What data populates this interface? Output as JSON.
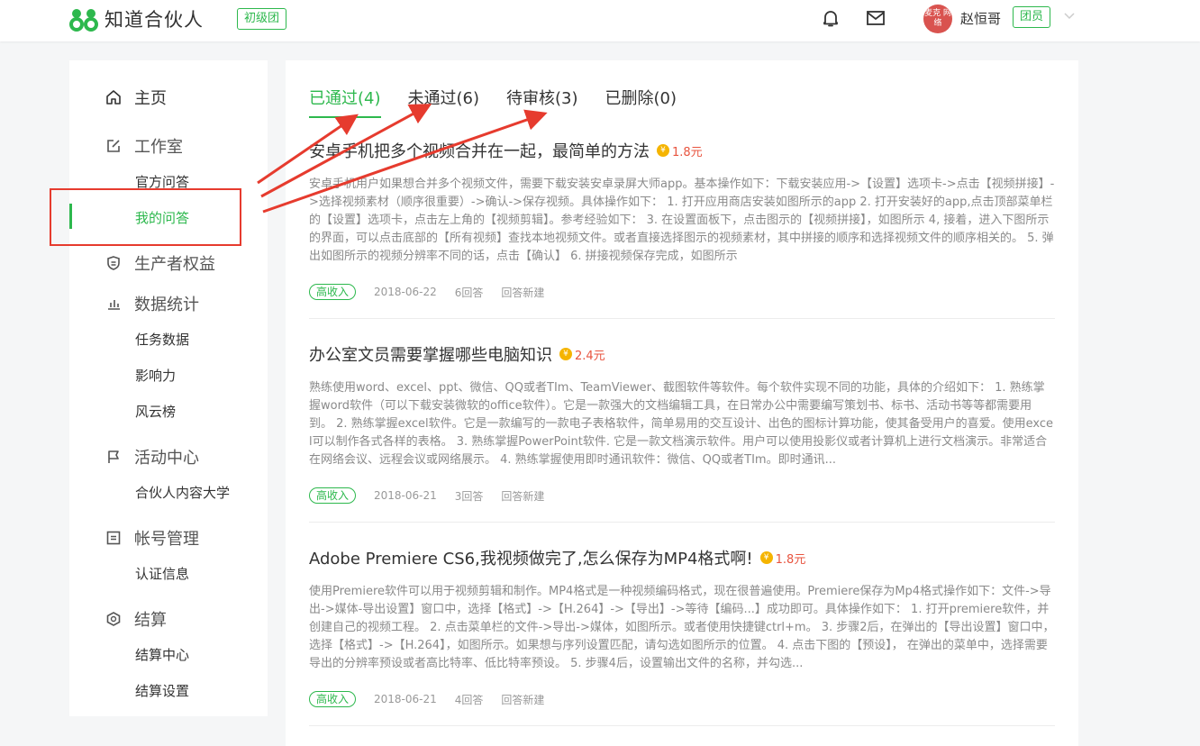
{
  "header": {
    "logo_text": "知道合伙人",
    "level_badge": "初级团",
    "avatar_text": "麦克 网络",
    "username": "赵恒哥",
    "role_badge": "团员"
  },
  "sidebar": {
    "home": "主页",
    "studio": "工作室",
    "official_qa": "官方问答",
    "my_qa": "我的问答",
    "producer_rights": "生产者权益",
    "data_stats": "数据统计",
    "task_data": "任务数据",
    "influence": "影响力",
    "leaderboard": "风云榜",
    "activity_center": "活动中心",
    "partner_university": "合伙人内容大学",
    "account_mgmt": "帐号管理",
    "cert_info": "认证信息",
    "settlement": "结算",
    "settlement_center": "结算中心",
    "settlement_settings": "结算设置"
  },
  "tabs": [
    {
      "label": "已通过(4)"
    },
    {
      "label": "未通过(6)"
    },
    {
      "label": "待审核(3)"
    },
    {
      "label": "已删除(0)"
    }
  ],
  "articles": [
    {
      "title": "安卓手机把多个视频合并在一起，最简单的方法",
      "reward": "1.8元",
      "body": "安卓手机用户如果想合并多个视频文件，需要下载安装安卓录屏大师app。基本操作如下：下载安装应用->【设置】选项卡->点击【视频拼接】->选择视频素材（顺序很重要）->确认->保存视频。具体操作如下： 1. 打开应用商店安装如图所示的app 2. 打开安装好的app,点击顶部菜单栏的【设置】选项卡，点击左上角的【视频剪辑】。参考经验如下： 3. 在设置面板下，点击图示的【视频拼接】，如图所示 4, 接着，进入下图所示的界面，可以点击底部的【所有视频】查找本地视频文件。或者直接选择图示的视频素材，其中拼接的顺序和选择视频文件的顺序相关的。 5. 弹出如图所示的视频分辨率不同的话，点击【确认】 6. 拼接视频保存完成，如图所示",
      "tag": "高收入",
      "date": "2018-06-22",
      "answers": "6回答",
      "action": "回答新建"
    },
    {
      "title": "办公室文员需要掌握哪些电脑知识",
      "reward": "2.4元",
      "body": "熟练使用word、excel、ppt、微信、QQ或者TIm、TeamViewer、截图软件等软件。每个软件实现不同的功能，具体的介绍如下： 1. 熟练掌握word软件（可以下载安装微软的office软件）。它是一款强大的文档编辑工具，在日常办公中需要编写策划书、标书、活动书等等都需要用到。 2. 熟练掌握excel软件。它是一款编写的一款电子表格软件，简单易用的交互设计、出色的图标计算功能，使其备受用户的喜爱。使用excel可以制作各式各样的表格。 3. 熟练掌握PowerPoint软件. 它是一款文档演示软件。用户可以使用投影仪或者计算机上进行文档演示。非常适合在网络会议、远程会议或网络展示。 4. 熟练掌握使用即时通讯软件：微信、QQ或者TIm。即时通讯...",
      "tag": "高收入",
      "date": "2018-06-21",
      "answers": "3回答",
      "action": "回答新建"
    },
    {
      "title": "Adobe Premiere CS6,我视频做完了,怎么保存为MP4格式啊!",
      "reward": "1.8元",
      "body": "使用Premiere软件可以用于视频剪辑和制作。MP4格式是一种视频编码格式，现在很普遍使用。Premiere保存为Mp4格式操作如下：文件->导出->媒体-导出设置】窗口中，选择【格式】->【H.264】->【导出】->等待【编码...】成功即可。具体操作如下： 1. 打开premiere软件，并创建自己的视频工程。 2. 点击菜单栏的文件->导出->媒体，如图所示。或者使用快捷键ctrl+m。 3. 步骤2后，在弹出的【导出设置】窗口中，选择【格式】->【H.264】，如图所示。如果想与序列设置匹配，请勾选如图所示的位置。 4. 点击下图的【预设】， 在弹出的菜单中，选择需要导出的分辨率预设或者高比特率、低比特率预设。 5. 步骤4后，设置输出文件的名称，并勾选...",
      "tag": "高收入",
      "date": "2018-06-21",
      "answers": "4回答",
      "action": "回答新建"
    }
  ],
  "colors": {
    "brand_green": "#2db84d",
    "reward_red": "#e8543f",
    "annotation_red": "#e63b2e",
    "coin_gold": "#f5b400"
  }
}
